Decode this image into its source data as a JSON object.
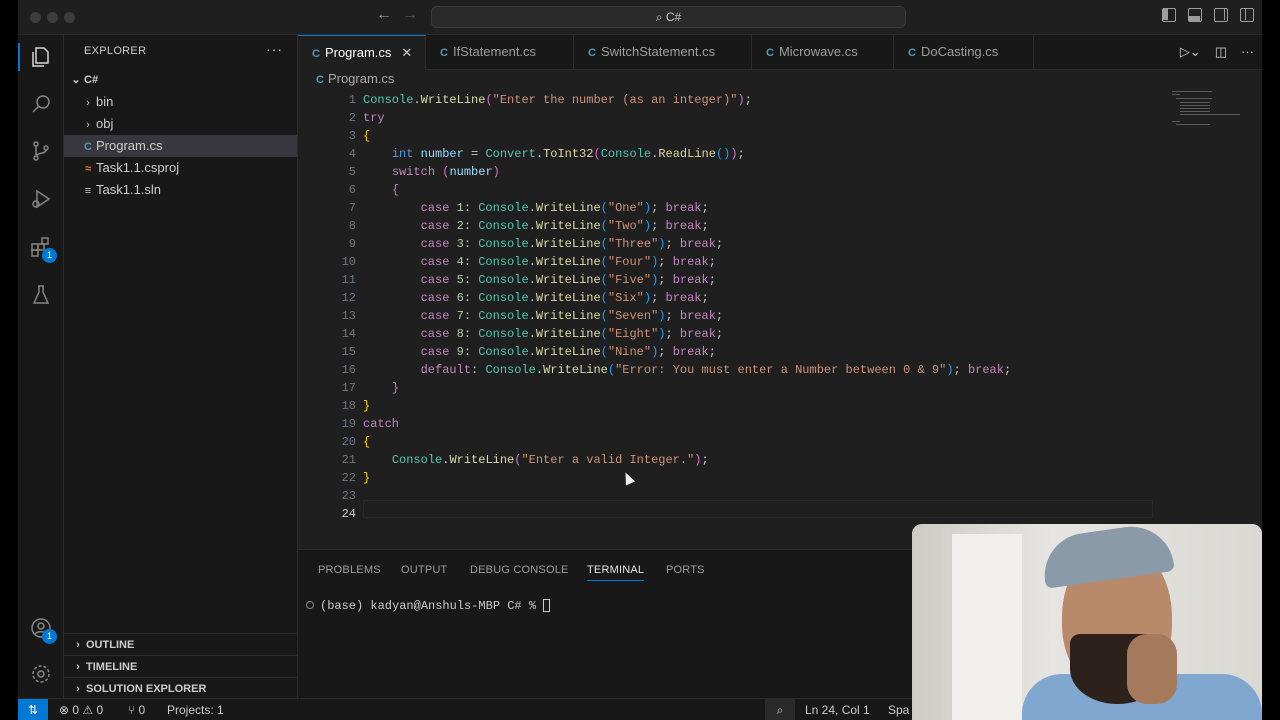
{
  "titlebar": {
    "search_text": "C#",
    "search_icon": "search-icon",
    "back_icon": "arrow-left-icon",
    "forward_icon": "arrow-right-icon"
  },
  "activity_bar": {
    "items": [
      "explorer-icon",
      "search-icon",
      "source-control-icon",
      "run-debug-icon",
      "extensions-icon",
      "testing-icon"
    ],
    "extensions_badge": "1",
    "accounts_badge": "1"
  },
  "explorer": {
    "title": "EXPLORER",
    "more": "···",
    "root": "C#",
    "items": [
      {
        "label": "bin",
        "type": "folder"
      },
      {
        "label": "obj",
        "type": "folder"
      },
      {
        "label": "Program.cs",
        "type": "cs"
      },
      {
        "label": "Task1.1.csproj",
        "type": "rss"
      },
      {
        "label": "Task1.1.sln",
        "type": "sln"
      }
    ],
    "sections": [
      "OUTLINE",
      "TIMELINE",
      "SOLUTION EXPLORER"
    ]
  },
  "tabs": [
    {
      "label": "Program.cs",
      "active": true
    },
    {
      "label": "IfStatement.cs",
      "active": false
    },
    {
      "label": "SwitchStatement.cs",
      "active": false
    },
    {
      "label": "Microwave.cs",
      "active": false
    },
    {
      "label": "DoCasting.cs",
      "active": false
    }
  ],
  "breadcrumb": "Program.cs",
  "code": {
    "line_numbers": [
      "1",
      "2",
      "3",
      "4",
      "5",
      "6",
      "7",
      "8",
      "9",
      "10",
      "11",
      "12",
      "13",
      "14",
      "15",
      "16",
      "17",
      "18",
      "19",
      "20",
      "21",
      "22",
      "23",
      "24"
    ],
    "current_line": "24"
  },
  "panel": {
    "tabs": [
      "PROBLEMS",
      "OUTPUT",
      "DEBUG CONSOLE",
      "TERMINAL",
      "PORTS"
    ],
    "active_tab": "TERMINAL",
    "terminal_prompt": "(base) kadyan@Anshuls-MBP C# % "
  },
  "statusbar": {
    "errors": "0",
    "warnings": "0",
    "ports": "0",
    "projects": "Projects: 1",
    "position": "Ln 24, Col 1",
    "spaces": "Spa"
  },
  "colors": {
    "accent": "#0078d4",
    "keyword": "#c586c0",
    "type": "#4ec9b0",
    "function": "#dcdcaa",
    "string": "#ce9178",
    "number": "#b5cea8"
  }
}
